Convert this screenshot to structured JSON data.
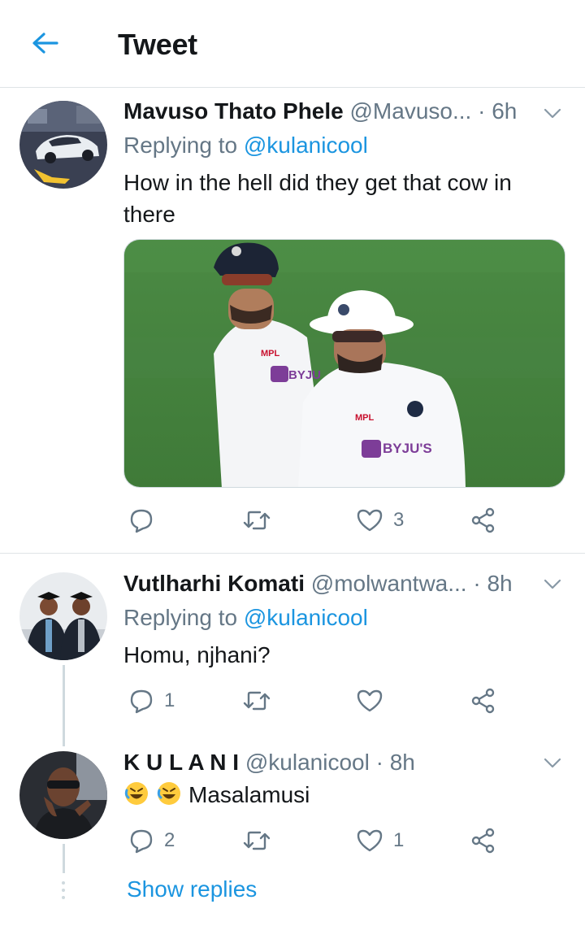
{
  "header": {
    "title": "Tweet"
  },
  "tweets": [
    {
      "name": "Mavuso Thato Phele",
      "handle": "@Mavuso...",
      "time": "· 6h",
      "replying_prefix": "Replying to ",
      "replying_to": "@kulanicool",
      "text": "How in the hell did they get that cow in there",
      "reply_count": "",
      "retweet_count": "",
      "like_count": "3"
    },
    {
      "name": "Vutlharhi Komati",
      "handle": "@molwantwa...",
      "time": "· 8h",
      "replying_prefix": "Replying to ",
      "replying_to": "@kulanicool",
      "text": "Homu, njhani?",
      "reply_count": "1",
      "retweet_count": "",
      "like_count": ""
    },
    {
      "name": "K U L A N I",
      "handle": "@kulanicool",
      "time": "· 8h",
      "text": "Masalamusi",
      "emoji": [
        "rolling-on-floor-laughing",
        "rolling-on-floor-laughing"
      ],
      "reply_count": "2",
      "retweet_count": "",
      "like_count": "1"
    }
  ],
  "show_replies": "Show replies",
  "media": {
    "jersey_brand_1": "MPL",
    "jersey_sponsor_1": "BYJU",
    "jersey_brand_2": "MPL",
    "jersey_sponsor_2": "BYJU'S"
  },
  "colors": {
    "accent": "#1b95e0",
    "secondary_text": "#657786",
    "divider": "#dfe3e6"
  }
}
